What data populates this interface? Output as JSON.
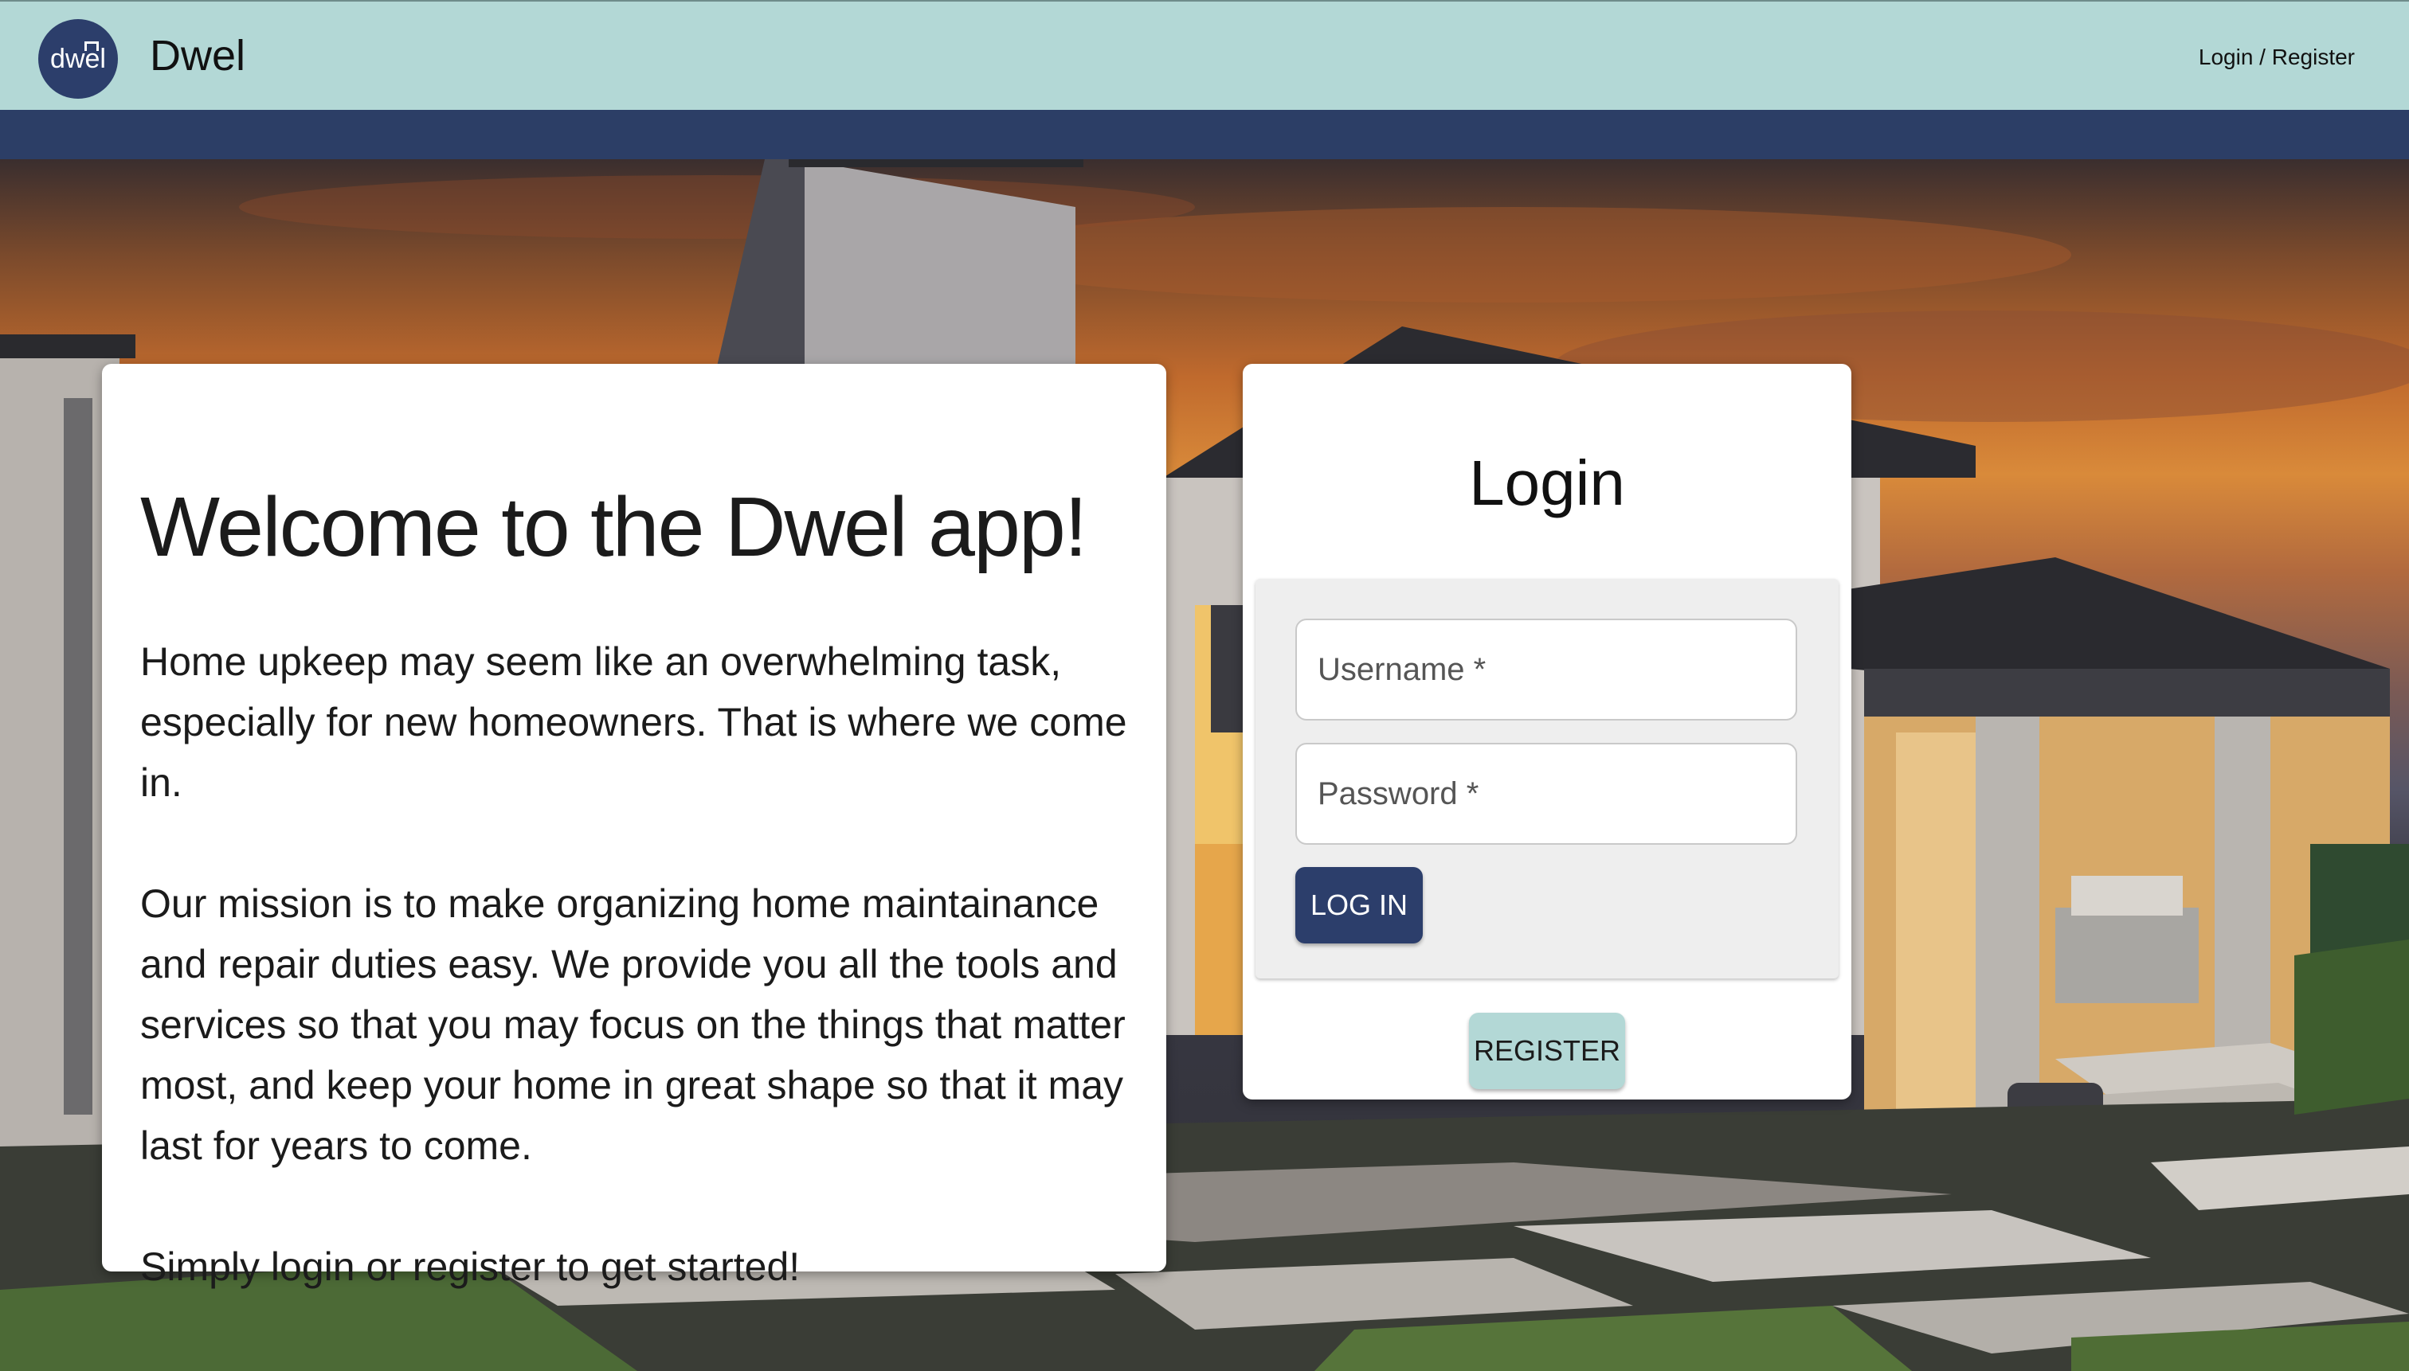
{
  "header": {
    "logo_text": "dwel",
    "app_title": "Dwel",
    "nav_link": "Login / Register"
  },
  "welcome": {
    "title": "Welcome to the Dwel app!",
    "paragraph1": "Home upkeep may seem like an overwhelming task, especially for new homeowners. That is where we come in.",
    "paragraph2": "Our mission is to make organizing home maintainance and repair duties easy. We provide you all the tools and services so that you may focus on the things that matter most, and keep your home in great shape so that it may last for years to come.",
    "paragraph3": "Simply login or register to get started!"
  },
  "login": {
    "title": "Login",
    "username_placeholder": "Username *",
    "password_placeholder": "Password *",
    "login_button": "LOG IN",
    "register_button": "REGISTER"
  },
  "colors": {
    "header_bg": "#b3d8d6",
    "navy": "#2c3e6b",
    "register_bg": "#b3d8d6"
  }
}
